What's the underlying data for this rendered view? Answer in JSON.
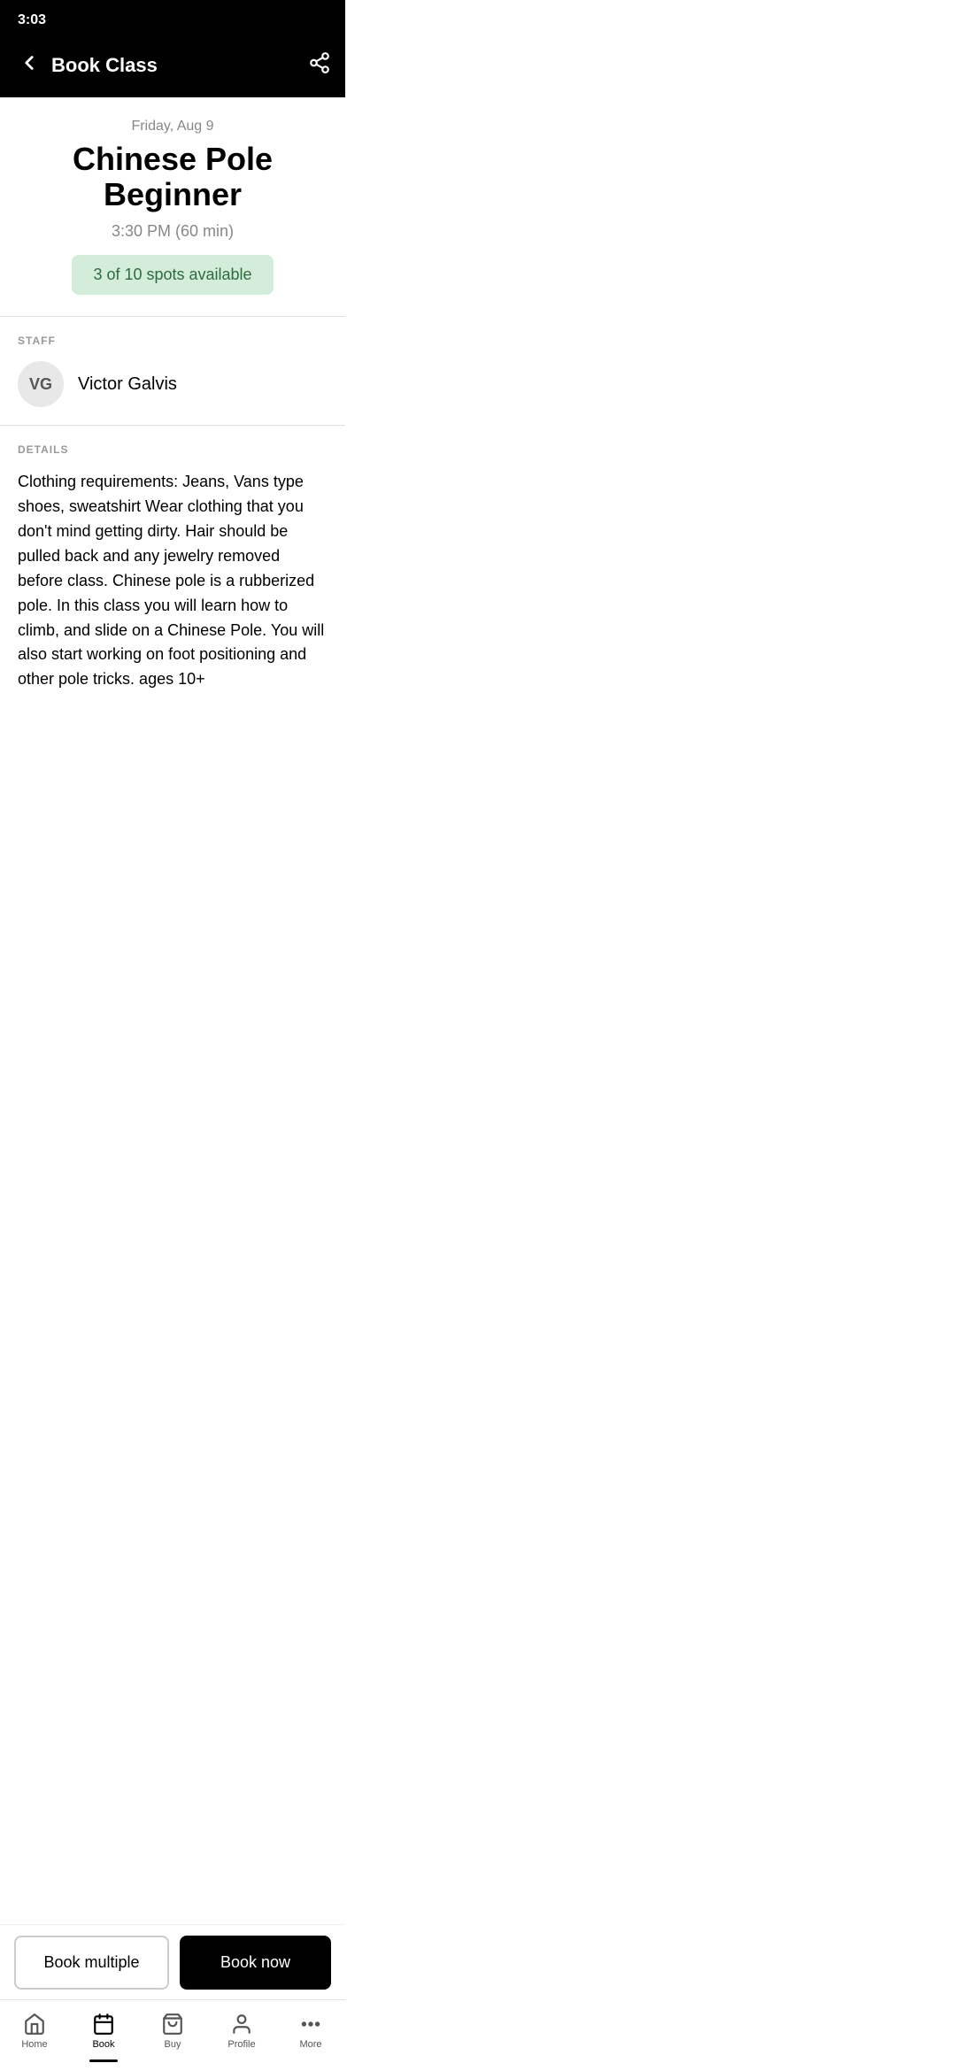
{
  "statusBar": {
    "time": "3:03"
  },
  "header": {
    "title": "Book Class",
    "backLabel": "←",
    "shareLabel": "share"
  },
  "classInfo": {
    "date": "Friday, Aug 9",
    "title": "Chinese Pole Beginner",
    "time": "3:30 PM (60 min)",
    "spotsAvailable": "3 of 10 spots available"
  },
  "staff": {
    "sectionLabel": "STAFF",
    "initials": "VG",
    "name": "Victor Galvis"
  },
  "details": {
    "sectionLabel": "DETAILS",
    "text": "Clothing requirements: Jeans, Vans type shoes, sweatshirt   Wear clothing that you don't mind getting dirty.  Hair should be pulled back and any jewelry removed before class.  Chinese pole is a rubberized pole.  In this class you will learn how to climb, and slide on a Chinese Pole.  You will also start working on foot positioning and other pole tricks.  ages 10+"
  },
  "actions": {
    "bookMultiple": "Book multiple",
    "bookNow": "Book now"
  },
  "bottomNav": {
    "items": [
      {
        "id": "home",
        "label": "Home",
        "active": false
      },
      {
        "id": "book",
        "label": "Book",
        "active": true
      },
      {
        "id": "buy",
        "label": "Buy",
        "active": false
      },
      {
        "id": "profile",
        "label": "Profile",
        "active": false
      },
      {
        "id": "more",
        "label": "More",
        "active": false
      }
    ]
  }
}
